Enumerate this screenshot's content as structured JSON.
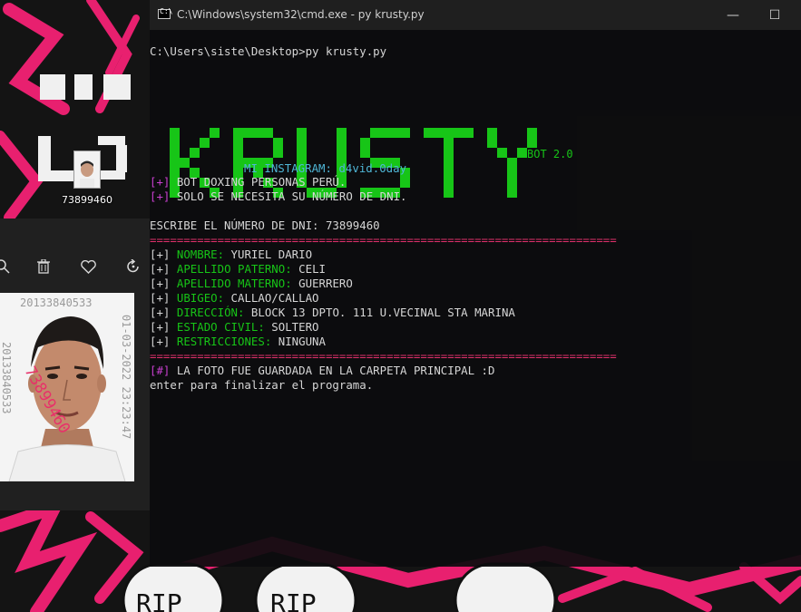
{
  "desktop": {
    "file_label": "73899460"
  },
  "photo_viewer": {
    "toolbar": [
      "zoom-icon",
      "delete-icon",
      "favorite-icon",
      "rotate-icon"
    ],
    "photo_stamps": {
      "top": "20133840533",
      "left": "20133840533",
      "right": "01-03-2022 23:23:47",
      "overlay": "73899460"
    }
  },
  "cmd": {
    "title": "C:\\Windows\\system32\\cmd.exe - py  krusty.py",
    "controls": {
      "minimize": "—",
      "maximize": "☐"
    },
    "prompt": "C:\\Users\\siste\\Desktop>py krusty.py",
    "banner": {
      "logo": "KRUSTY",
      "version": "BOT 2.0",
      "instagram_label": "MI INSTAGRAM:",
      "instagram_handle": "d4vid.0day"
    },
    "intro": [
      {
        "tag": "[+]",
        "text": " BOT DOXING PERSONAS PERÚ."
      },
      {
        "tag": "[+]",
        "text": " SOLO SE NECESITA SU NÚMERO DE DNI."
      }
    ],
    "dni_prompt": "ESCRIBE EL NÚMERO DE DNI: 73899460",
    "separator": "=====================================================================",
    "results": [
      {
        "tag": "[+]",
        "key": "NOMBRE:",
        "value": " YURIEL DARIO"
      },
      {
        "tag": "[+]",
        "key": "APELLIDO PATERNO:",
        "value": " CELI"
      },
      {
        "tag": "[+]",
        "key": "APELLIDO MATERNO:",
        "value": " GUERRERO"
      },
      {
        "tag": "[+]",
        "key": "UBIGEO:",
        "value": " CALLAO/CALLAO"
      },
      {
        "tag": "[+]",
        "key": "DIRECCIÓN:",
        "value": " BLOCK 13 DPTO. 111 U.VECINAL STA MARINA"
      },
      {
        "tag": "[+]",
        "key": "ESTADO CIVIL:",
        "value": " SOLTERO"
      },
      {
        "tag": "[+]",
        "key": "RESTRICCIONES:",
        "value": " NINGUNA"
      }
    ],
    "photo_tag": "[#]",
    "photo_saved": " LA FOTO FUE GUARDADA EN LA CARPETA PRINCIPAL :D",
    "exit_msg": "enter para finalizar el programa."
  },
  "colors": {
    "accent_pink": "#e8206f",
    "banner_green": "#17c517",
    "tag_magenta": "#c93fd0",
    "instagram_cyan": "#4fb6d6"
  }
}
